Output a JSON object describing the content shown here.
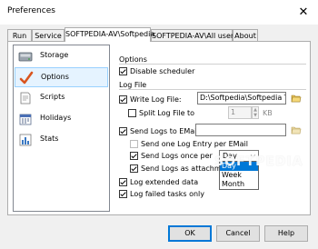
{
  "window": {
    "title": "Preferences",
    "close_glyph": "✕"
  },
  "tabs": [
    "Run",
    "Service",
    "SOFTPEDIA-AV\\Softpedia",
    "SOFTPEDIA-AV\\All users",
    "About"
  ],
  "nav": {
    "items": [
      {
        "label": "Storage",
        "icon": "storage-icon"
      },
      {
        "label": "Options",
        "icon": "checkmark-icon"
      },
      {
        "label": "Scripts",
        "icon": "scripts-icon"
      },
      {
        "label": "Holidays",
        "icon": "calendar-icon"
      },
      {
        "label": "Stats",
        "icon": "stats-chart-icon"
      }
    ],
    "selected": "Options"
  },
  "options_group": {
    "title": "Options",
    "disable_scheduler": {
      "label": "Disable scheduler",
      "checked": true
    }
  },
  "logfile_group": {
    "title": "Log File",
    "write_log_file": {
      "label": "Write Log File:",
      "checked": true,
      "value": "D:\\Softpedia\\Softpedia Tes"
    },
    "split_log_file": {
      "label": "Split Log File to",
      "checked": false,
      "value": "1",
      "unit": "KB"
    },
    "send_logs_email": {
      "label": "Send Logs to EMail:",
      "checked": true
    },
    "send_one_entry": {
      "label": "Send one Log Entry per EMail",
      "checked": false
    },
    "send_logs_once_per": {
      "label": "Send Logs once per",
      "checked": true,
      "selected": "Day",
      "options": [
        "Day",
        "Week",
        "Month"
      ],
      "highlighted": "Day"
    },
    "send_as_attachment": {
      "label": "Send Logs as attachment",
      "checked": true
    },
    "log_extended": {
      "label": "Log extended data",
      "checked": true
    },
    "log_failed": {
      "label": "Log failed tasks only",
      "checked": true
    }
  },
  "watermark": "SOFTPEDIA",
  "buttons": {
    "ok": "OK",
    "cancel": "Cancel",
    "help": "Help"
  },
  "colors": {
    "accent": "#0078d7",
    "selected_bg": "#e5f3ff",
    "selected_border": "#99d1ff"
  }
}
